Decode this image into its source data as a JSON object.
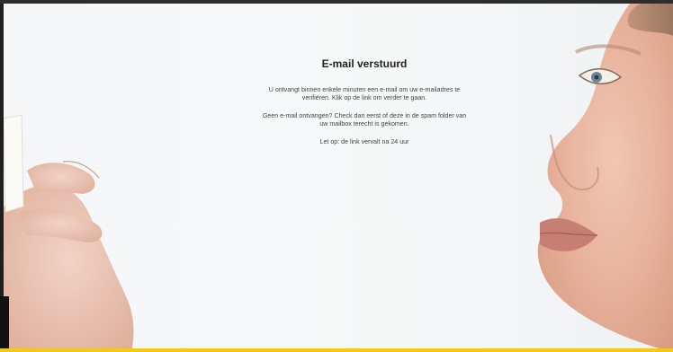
{
  "confirmation": {
    "title": "E-mail verstuurd",
    "paragraph1": {
      "line1": "U ontvangt binnen enkele minuten een e-mail om uw e-mailadres te",
      "line2": "verifiëren. Klik op de link om verder te gaan."
    },
    "paragraph2": {
      "line1": "Geen e-mail ontvangen? Check dan eerst of deze in de spam folder van",
      "line2": "uw mailbox terecht is gekomen."
    },
    "note": "Let op: de link vervalt na 24 uur"
  },
  "colors": {
    "accent_stripe": "#f2c81a",
    "background": "#f5f7f8",
    "text": "#333333"
  }
}
